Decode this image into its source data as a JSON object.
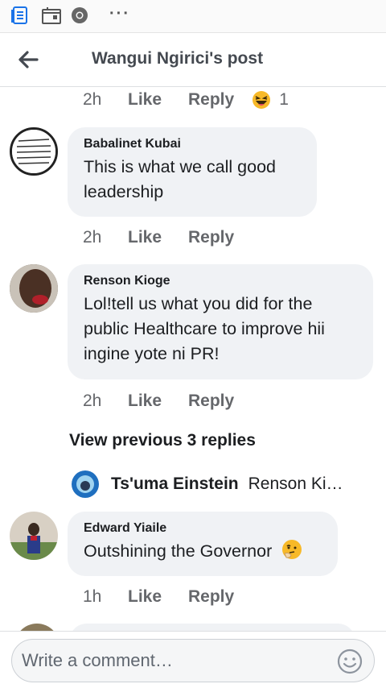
{
  "header": {
    "title": "Wangui Ngirici's post"
  },
  "top_meta": {
    "time": "2h",
    "like": "Like",
    "reply": "Reply",
    "reaction_count": "1"
  },
  "comments": [
    {
      "author": "Babalinet Kubai",
      "text": "This is what we call good leadership",
      "time": "2h",
      "like": "Like",
      "reply": "Reply"
    },
    {
      "author": "Renson Kioge",
      "text": "Lol!tell us what you did for the public Healthcare to improve hii ingine yote ni PR!",
      "time": "2h",
      "like": "Like",
      "reply": "Reply"
    },
    {
      "author": "Edward Yiaile",
      "text": "Outshining the Governor",
      "time": "1h",
      "like": "Like",
      "reply": "Reply"
    }
  ],
  "view_previous": "View previous 3 replies",
  "reply_preview": {
    "author": "Ts'uma Einstein",
    "snippet": "Renson Ki…"
  },
  "composer": {
    "placeholder": "Write a comment…"
  },
  "colors": {
    "bubble": "#f0f2f5",
    "meta_text": "#65676b",
    "header_text": "#444950"
  },
  "icons": [
    "doc-icon",
    "calendar-icon",
    "chrome-icon",
    "more-dots-icon",
    "back-arrow-icon",
    "laughing-emoji-icon",
    "thinking-emoji-icon",
    "smiley-icon"
  ]
}
